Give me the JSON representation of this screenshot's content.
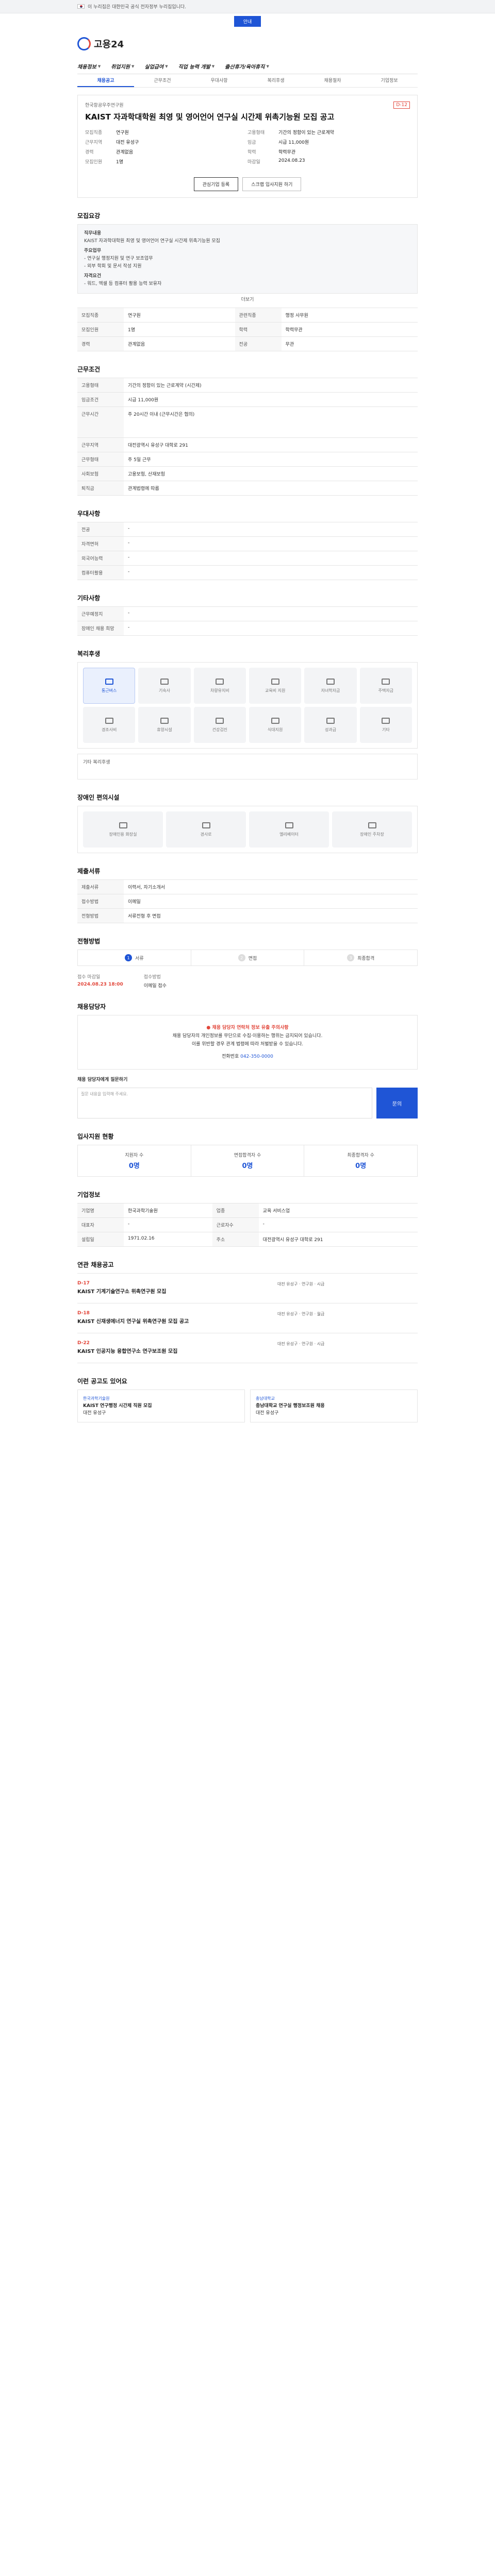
{
  "gov_notice": "이 누리집은 대한민국 공식 전자정부 누리집입니다.",
  "top_pill": "안내",
  "logo": "고용24",
  "gnb": [
    "채용정보",
    "취업지원",
    "실업급여",
    "직업 능력 개발",
    "출산휴가/육아휴직"
  ],
  "subtabs": [
    "채용공고",
    "근무조건",
    "우대사항",
    "복리후생",
    "채용절차",
    "기업정보"
  ],
  "job": {
    "company": "한국항공우주연구원",
    "dday": "D-12",
    "title": "KAIST 자과학대학원 최영 및 영어언어 연구실 시간제 위촉기능원 모집 공고",
    "summary": [
      {
        "k": "모집직종",
        "v": "연구원"
      },
      {
        "k": "고용형태",
        "v": "기간의 정함이 있는 근로계약"
      },
      {
        "k": "근무지역",
        "v": "대전 유성구"
      },
      {
        "k": "임금",
        "v": "시급 11,000원"
      },
      {
        "k": "경력",
        "v": "관계없음"
      },
      {
        "k": "학력",
        "v": "학력무관"
      },
      {
        "k": "모집인원",
        "v": "1명"
      },
      {
        "k": "마감일",
        "v": "2024.08.23"
      }
    ],
    "btn_interest": "관심기업 등록",
    "btn_save": "스크랩 입사지원 하기"
  },
  "sections": {
    "recruit": "모집요강",
    "conditions": "근무조건",
    "preferences": "우대사항",
    "other": "기타사항",
    "welfare": "복리후생",
    "disability": "장애인 편의시설",
    "submit": "제출서류",
    "process": "전형방법",
    "inquiry": "채용담당자",
    "stats": "입사지원 현황",
    "company": "기업정보",
    "related": "연관 채용공고",
    "recommend": "이런 공고도 있어요"
  },
  "recruit_box": {
    "lines": [
      "직무내용",
      "KAIST 자과학대학원 최영 및 영어언어 연구실 시간제 위촉기능원 모집",
      "주요업무",
      "- 연구실 행정지원 및 연구 보조업무",
      "- 외부 학회 및 문서 작성 지원",
      "자격요건",
      "- 워드, 엑셀 등 컴퓨터 활용 능력 보유자"
    ],
    "more": "더보기"
  },
  "recruit_table": [
    {
      "k": "모집직종",
      "v": "연구원"
    },
    {
      "k": "관련직종",
      "v": "행정 사무원"
    },
    {
      "k": "모집인원",
      "v": "1명"
    },
    {
      "k": "학력",
      "v": "학력무관"
    },
    {
      "k": "경력",
      "v": "관계없음"
    },
    {
      "k": "전공",
      "v": "무관"
    }
  ],
  "conditions_table": [
    {
      "k": "고용형태",
      "v": "기간의 정함이 있는 근로계약 (시간제)"
    },
    {
      "k": "임금조건",
      "v": "시급 11,000원"
    },
    {
      "k": "근무시간",
      "v": "주 20시간 이내 (근무시간은 협의)"
    },
    {
      "k": "근무지역",
      "v": "대전광역시 유성구 대학로 291"
    },
    {
      "k": "근무형태",
      "v": "주 5일 근무"
    },
    {
      "k": "사회보험",
      "v": "고용보험, 산재보험"
    },
    {
      "k": "퇴직금",
      "v": "관계법령에 따름"
    }
  ],
  "pref_table": [
    {
      "k": "전공",
      "v": "-"
    },
    {
      "k": "자격면허",
      "v": "-"
    },
    {
      "k": "외국어능력",
      "v": "-"
    },
    {
      "k": "컴퓨터활용",
      "v": "-"
    }
  ],
  "other_table": [
    {
      "k": "근무예정지",
      "v": "-"
    },
    {
      "k": "장애인 채용 희망",
      "v": "-"
    }
  ],
  "welfare_items": [
    {
      "label": "통근버스",
      "on": true
    },
    {
      "label": "기숙사",
      "on": false
    },
    {
      "label": "차량유지비",
      "on": false
    },
    {
      "label": "교육비 지원",
      "on": false
    },
    {
      "label": "자녀학자금",
      "on": false
    },
    {
      "label": "주택자금",
      "on": false
    },
    {
      "label": "경조사비",
      "on": false
    },
    {
      "label": "휴양시설",
      "on": false
    },
    {
      "label": "건강검진",
      "on": false
    },
    {
      "label": "식대지원",
      "on": false
    },
    {
      "label": "성과급",
      "on": false
    },
    {
      "label": "기타",
      "on": false
    }
  ],
  "welfare_note": "기타 복리후생",
  "disability_items": [
    "장애인용 화장실",
    "경사로",
    "엘리베이터",
    "장애인 주차장"
  ],
  "submit_table": [
    {
      "k": "제출서류",
      "v": "이력서, 자기소개서"
    },
    {
      "k": "접수방법",
      "v": "이메일"
    },
    {
      "k": "전형방법",
      "v": "서류전형 후 면접"
    }
  ],
  "steps": [
    "서류",
    "면접",
    "최종합격"
  ],
  "deadline": {
    "label": "접수 마감일",
    "value": "2024.08.23 18:00",
    "method_label": "접수방법",
    "method": "이메일 접수"
  },
  "notice": {
    "red": "● 채용 담당자 연락처 정보 유출 주의사항",
    "lines": [
      "채용 담당자의 개인정보를 무단으로 수집·이용하는 행위는 금지되어 있습니다.",
      "이를 위반할 경우 관계 법령에 따라 처벌받을 수 있습니다."
    ],
    "phone_label": "전화번호",
    "phone": "042-350-0000"
  },
  "inquiry": {
    "label": "채용 담당자에게 질문하기",
    "placeholder": "질문 내용을 입력해 주세요.",
    "btn": "문의"
  },
  "stats": [
    {
      "label": "지원자 수",
      "value": "0명"
    },
    {
      "label": "면접합격자 수",
      "value": "0명"
    },
    {
      "label": "최종합격자 수",
      "value": "0명"
    }
  ],
  "company_table": [
    {
      "k": "기업명",
      "v": "한국과학기술원"
    },
    {
      "k": "업종",
      "v": "교육 서비스업"
    },
    {
      "k": "대표자",
      "v": "-"
    },
    {
      "k": "근로자수",
      "v": "-"
    },
    {
      "k": "설립일",
      "v": "1971.02.16"
    },
    {
      "k": "주소",
      "v": "대전광역시 유성구 대학로 291"
    }
  ],
  "related": [
    {
      "dday": "D-17",
      "title": "KAIST 기계기술연구소 위촉연구원 모집",
      "meta": "대전 유성구 · 연구원 · 시급"
    },
    {
      "dday": "D-18",
      "title": "KAIST 신재생에너지 연구실 위촉연구원 모집 공고",
      "meta": "대전 유성구 · 연구원 · 월급"
    },
    {
      "dday": "D-22",
      "title": "KAIST 인공지능 융합연구소 연구보조원 모집",
      "meta": "대전 유성구 · 연구원 · 시급"
    }
  ],
  "recommend": [
    {
      "co": "한국과학기술원",
      "title": "KAIST 연구행정 시간제 직원 모집",
      "meta": "대전 유성구"
    },
    {
      "co": "충남대학교",
      "title": "충남대학교 연구실 행정보조원 채용",
      "meta": "대전 유성구"
    }
  ]
}
